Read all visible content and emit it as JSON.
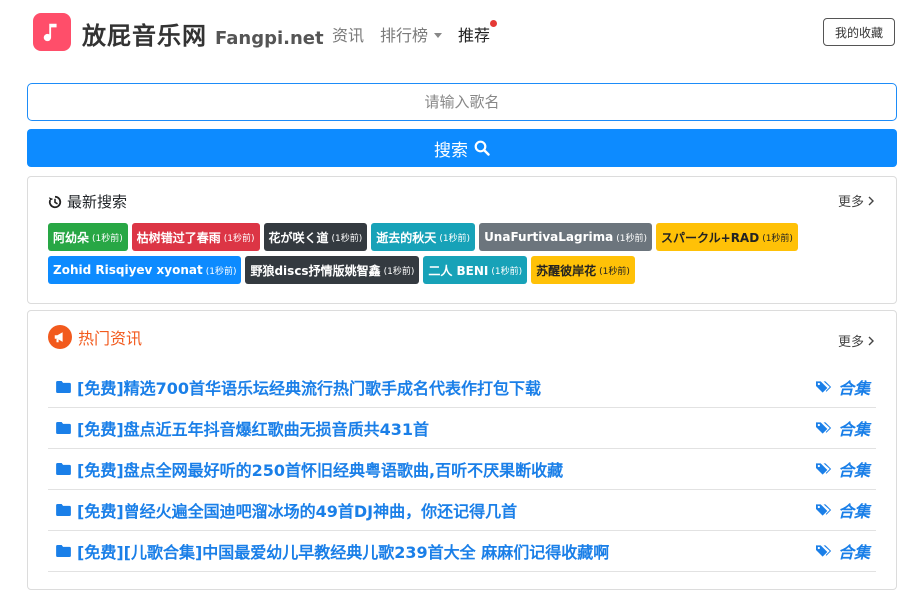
{
  "header": {
    "brand_cn": "放屁音乐网",
    "brand_en": "Fangpi.net",
    "nav": [
      {
        "label": "资讯"
      },
      {
        "label": "排行榜"
      },
      {
        "label": "推荐"
      }
    ],
    "favorites_label": "我的收藏"
  },
  "search": {
    "placeholder": "请输入歌名",
    "button_label": "搜索"
  },
  "recent": {
    "title": "最新搜索",
    "more": "更多",
    "tags": [
      {
        "name": "阿幼朵",
        "ago": "(1秒前)",
        "color": "#28a745"
      },
      {
        "name": "枯树错过了春雨",
        "ago": "(1秒前)",
        "color": "#dc3545"
      },
      {
        "name": "花が咲く道",
        "ago": "(1秒前)",
        "color": "#343a40"
      },
      {
        "name": "逝去的秋天",
        "ago": "(1秒前)",
        "color": "#17a2b8"
      },
      {
        "name": "UnaFurtivaLagrima",
        "ago": "(1秒前)",
        "color": "#6c757d"
      },
      {
        "name": "スパークル+RAD",
        "ago": "(1秒前)",
        "color": "#ffc107"
      },
      {
        "name": "Zohid Risqiyev xyonat",
        "ago": "(1秒前)",
        "color": "#0d8bff"
      },
      {
        "name": "野狼discs抒情版姚智鑫",
        "ago": "(1秒前)",
        "color": "#343a40"
      },
      {
        "name": "二人 BENI",
        "ago": "(1秒前)",
        "color": "#17a2b8"
      },
      {
        "name": "苏醒彼岸花",
        "ago": "(1秒前)",
        "color": "#ffc107"
      }
    ]
  },
  "hot": {
    "title": "热门资讯",
    "more": "更多",
    "items": [
      {
        "title": "[免费]精选700首华语乐坛经典流行热门歌手成名代表作打包下载",
        "tag": "合集"
      },
      {
        "title": "[免费]盘点近五年抖音爆红歌曲无损音质共431首",
        "tag": "合集"
      },
      {
        "title": "[免费]盘点全网最好听的250首怀旧经典粤语歌曲,百听不厌果断收藏",
        "tag": "合集"
      },
      {
        "title": "[免费]曾经火遍全国迪吧溜冰场的49首DJ神曲，你还记得几首",
        "tag": "合集"
      },
      {
        "title": "[免费][儿歌合集]中国最爱幼儿早教经典儿歌239首大全 麻麻们记得收藏啊",
        "tag": "合集"
      }
    ]
  }
}
